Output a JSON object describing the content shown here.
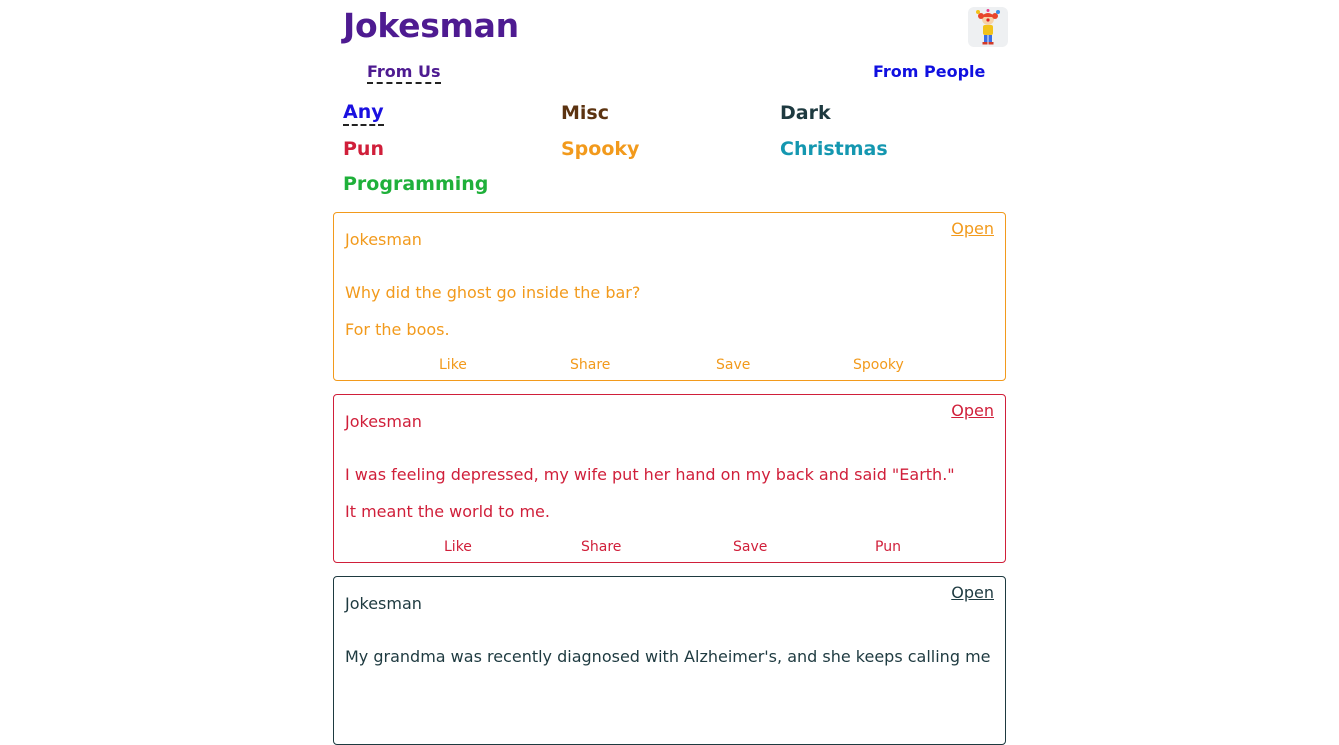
{
  "header": {
    "title": "Jokesman",
    "logo_icon": "clown-juggler-icon"
  },
  "source_tabs": {
    "from_us": "From Us",
    "from_people": "From People"
  },
  "categories": [
    {
      "label": "Any",
      "color": "#1a10e0"
    },
    {
      "label": "Misc",
      "color": "#5c3310"
    },
    {
      "label": "Dark",
      "color": "#1e3a40"
    },
    {
      "label": "Pun",
      "color": "#d01f3a"
    },
    {
      "label": "Spooky",
      "color": "#f29a1c"
    },
    {
      "label": "Christmas",
      "color": "#1497b0"
    },
    {
      "label": "Programming",
      "color": "#1fb03a"
    }
  ],
  "jokes": [
    {
      "author": "Jokesman",
      "open": "Open",
      "setup": "Why did the ghost go inside the bar?",
      "delivery": "For the boos.",
      "actions": {
        "like": "Like",
        "share": "Share",
        "save": "Save",
        "category": "Spooky"
      },
      "color": "#f29a1c"
    },
    {
      "author": "Jokesman",
      "open": "Open",
      "setup": "I was feeling depressed, my wife put her hand on my back and said \"Earth.\"",
      "delivery": "It meant the world to me.",
      "actions": {
        "like": "Like",
        "share": "Share",
        "save": "Save",
        "category": "Pun"
      },
      "color": "#d01f3a"
    },
    {
      "author": "Jokesman",
      "open": "Open",
      "setup": "My grandma was recently diagnosed with Alzheimer's, and she keeps calling me",
      "delivery": "",
      "actions": {
        "like": "",
        "share": "",
        "save": "",
        "category": ""
      },
      "color": "#1e3a40"
    }
  ]
}
